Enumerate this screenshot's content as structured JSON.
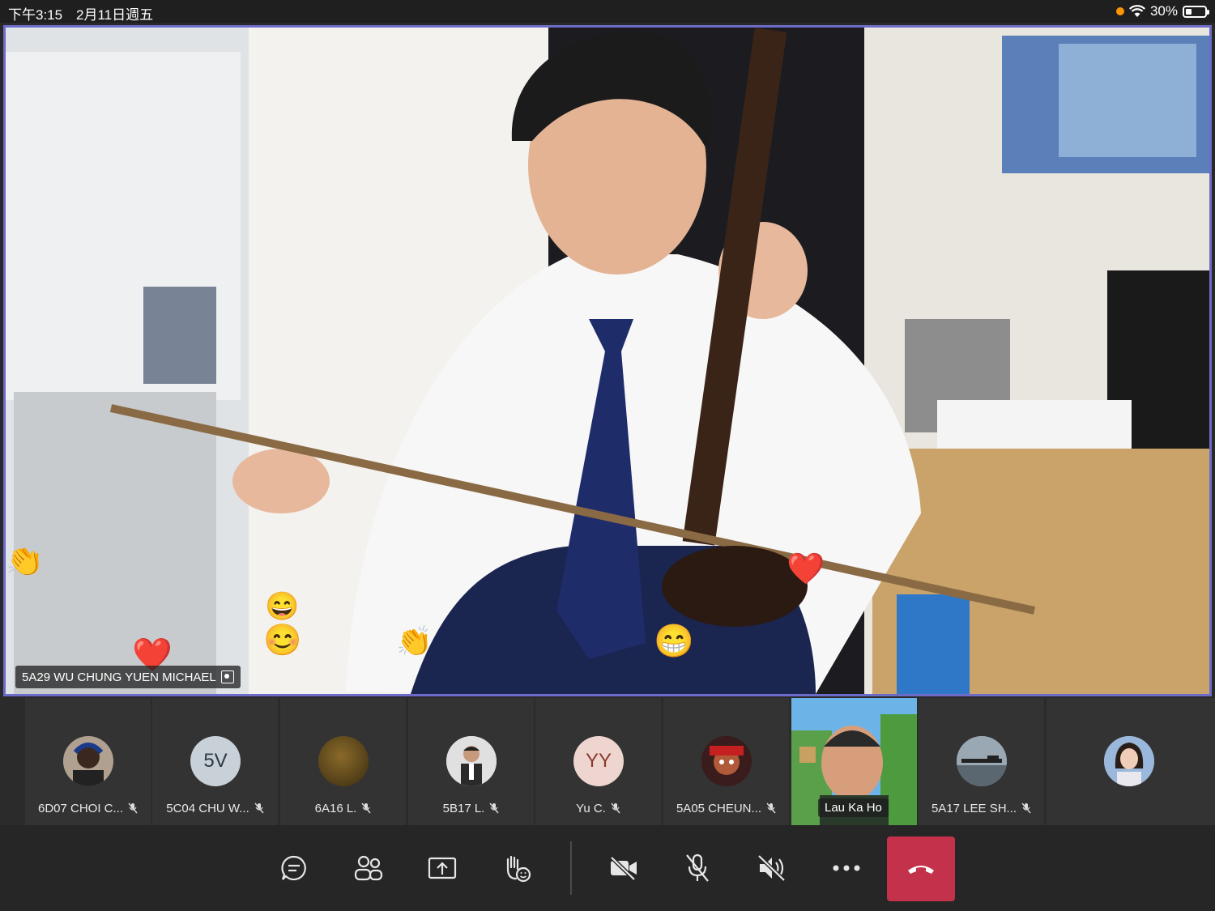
{
  "status_bar": {
    "time": "下午3:15",
    "date": "2月11日週五",
    "battery": "30%",
    "battery_level": 0.3
  },
  "main_video": {
    "participant_name": "5A29 WU CHUNG YUEN MICHAEL",
    "reactions": [
      "clap-emoji",
      "heart-emoji",
      "smile-emoji",
      "grin-emoji",
      "clap-emoji",
      "thumbs-laugh-emoji",
      "heart-emoji"
    ]
  },
  "participants": [
    {
      "label": "6D07 CHOI C...",
      "muted": true,
      "avatar": "photo"
    },
    {
      "label": "5C04 CHU W...",
      "muted": true,
      "avatar": "initials",
      "initials": "5V"
    },
    {
      "label": "6A16 L.",
      "muted": true,
      "avatar": "photo"
    },
    {
      "label": "5B17 L.",
      "muted": true,
      "avatar": "photo"
    },
    {
      "label": "Yu C.",
      "muted": true,
      "avatar": "initials",
      "initials": "YY"
    },
    {
      "label": "5A05 CHEUN...",
      "muted": true,
      "avatar": "photo"
    },
    {
      "label": "Lau Ka Ho",
      "muted": false,
      "avatar": "video"
    },
    {
      "label": "5A17 LEE SH...",
      "muted": true,
      "avatar": "photo"
    },
    {
      "label": "",
      "muted": false,
      "avatar": "photo"
    }
  ],
  "toolbar": {
    "buttons": [
      "chat-icon",
      "participants-icon",
      "share-icon",
      "raise-hand-icon",
      "camera-off-icon",
      "mic-off-icon",
      "speaker-off-icon",
      "more-icon",
      "hang-up-icon"
    ]
  },
  "colors": {
    "active_speaker_border": "#6d6bc8",
    "hangup": "#c4314b",
    "background": "#292929"
  }
}
